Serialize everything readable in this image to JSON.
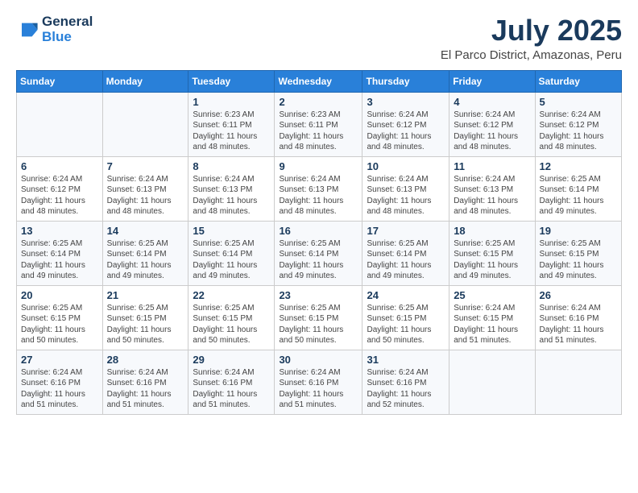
{
  "header": {
    "logo_general": "General",
    "logo_blue": "Blue",
    "title": "July 2025",
    "subtitle": "El Parco District, Amazonas, Peru"
  },
  "days_of_week": [
    "Sunday",
    "Monday",
    "Tuesday",
    "Wednesday",
    "Thursday",
    "Friday",
    "Saturday"
  ],
  "weeks": [
    [
      {
        "day": "",
        "info": ""
      },
      {
        "day": "",
        "info": ""
      },
      {
        "day": "1",
        "info": "Sunrise: 6:23 AM\nSunset: 6:11 PM\nDaylight: 11 hours and 48 minutes."
      },
      {
        "day": "2",
        "info": "Sunrise: 6:23 AM\nSunset: 6:11 PM\nDaylight: 11 hours and 48 minutes."
      },
      {
        "day": "3",
        "info": "Sunrise: 6:24 AM\nSunset: 6:12 PM\nDaylight: 11 hours and 48 minutes."
      },
      {
        "day": "4",
        "info": "Sunrise: 6:24 AM\nSunset: 6:12 PM\nDaylight: 11 hours and 48 minutes."
      },
      {
        "day": "5",
        "info": "Sunrise: 6:24 AM\nSunset: 6:12 PM\nDaylight: 11 hours and 48 minutes."
      }
    ],
    [
      {
        "day": "6",
        "info": "Sunrise: 6:24 AM\nSunset: 6:12 PM\nDaylight: 11 hours and 48 minutes."
      },
      {
        "day": "7",
        "info": "Sunrise: 6:24 AM\nSunset: 6:13 PM\nDaylight: 11 hours and 48 minutes."
      },
      {
        "day": "8",
        "info": "Sunrise: 6:24 AM\nSunset: 6:13 PM\nDaylight: 11 hours and 48 minutes."
      },
      {
        "day": "9",
        "info": "Sunrise: 6:24 AM\nSunset: 6:13 PM\nDaylight: 11 hours and 48 minutes."
      },
      {
        "day": "10",
        "info": "Sunrise: 6:24 AM\nSunset: 6:13 PM\nDaylight: 11 hours and 48 minutes."
      },
      {
        "day": "11",
        "info": "Sunrise: 6:24 AM\nSunset: 6:13 PM\nDaylight: 11 hours and 48 minutes."
      },
      {
        "day": "12",
        "info": "Sunrise: 6:25 AM\nSunset: 6:14 PM\nDaylight: 11 hours and 49 minutes."
      }
    ],
    [
      {
        "day": "13",
        "info": "Sunrise: 6:25 AM\nSunset: 6:14 PM\nDaylight: 11 hours and 49 minutes."
      },
      {
        "day": "14",
        "info": "Sunrise: 6:25 AM\nSunset: 6:14 PM\nDaylight: 11 hours and 49 minutes."
      },
      {
        "day": "15",
        "info": "Sunrise: 6:25 AM\nSunset: 6:14 PM\nDaylight: 11 hours and 49 minutes."
      },
      {
        "day": "16",
        "info": "Sunrise: 6:25 AM\nSunset: 6:14 PM\nDaylight: 11 hours and 49 minutes."
      },
      {
        "day": "17",
        "info": "Sunrise: 6:25 AM\nSunset: 6:14 PM\nDaylight: 11 hours and 49 minutes."
      },
      {
        "day": "18",
        "info": "Sunrise: 6:25 AM\nSunset: 6:15 PM\nDaylight: 11 hours and 49 minutes."
      },
      {
        "day": "19",
        "info": "Sunrise: 6:25 AM\nSunset: 6:15 PM\nDaylight: 11 hours and 49 minutes."
      }
    ],
    [
      {
        "day": "20",
        "info": "Sunrise: 6:25 AM\nSunset: 6:15 PM\nDaylight: 11 hours and 50 minutes."
      },
      {
        "day": "21",
        "info": "Sunrise: 6:25 AM\nSunset: 6:15 PM\nDaylight: 11 hours and 50 minutes."
      },
      {
        "day": "22",
        "info": "Sunrise: 6:25 AM\nSunset: 6:15 PM\nDaylight: 11 hours and 50 minutes."
      },
      {
        "day": "23",
        "info": "Sunrise: 6:25 AM\nSunset: 6:15 PM\nDaylight: 11 hours and 50 minutes."
      },
      {
        "day": "24",
        "info": "Sunrise: 6:25 AM\nSunset: 6:15 PM\nDaylight: 11 hours and 50 minutes."
      },
      {
        "day": "25",
        "info": "Sunrise: 6:24 AM\nSunset: 6:15 PM\nDaylight: 11 hours and 51 minutes."
      },
      {
        "day": "26",
        "info": "Sunrise: 6:24 AM\nSunset: 6:16 PM\nDaylight: 11 hours and 51 minutes."
      }
    ],
    [
      {
        "day": "27",
        "info": "Sunrise: 6:24 AM\nSunset: 6:16 PM\nDaylight: 11 hours and 51 minutes."
      },
      {
        "day": "28",
        "info": "Sunrise: 6:24 AM\nSunset: 6:16 PM\nDaylight: 11 hours and 51 minutes."
      },
      {
        "day": "29",
        "info": "Sunrise: 6:24 AM\nSunset: 6:16 PM\nDaylight: 11 hours and 51 minutes."
      },
      {
        "day": "30",
        "info": "Sunrise: 6:24 AM\nSunset: 6:16 PM\nDaylight: 11 hours and 51 minutes."
      },
      {
        "day": "31",
        "info": "Sunrise: 6:24 AM\nSunset: 6:16 PM\nDaylight: 11 hours and 52 minutes."
      },
      {
        "day": "",
        "info": ""
      },
      {
        "day": "",
        "info": ""
      }
    ]
  ]
}
